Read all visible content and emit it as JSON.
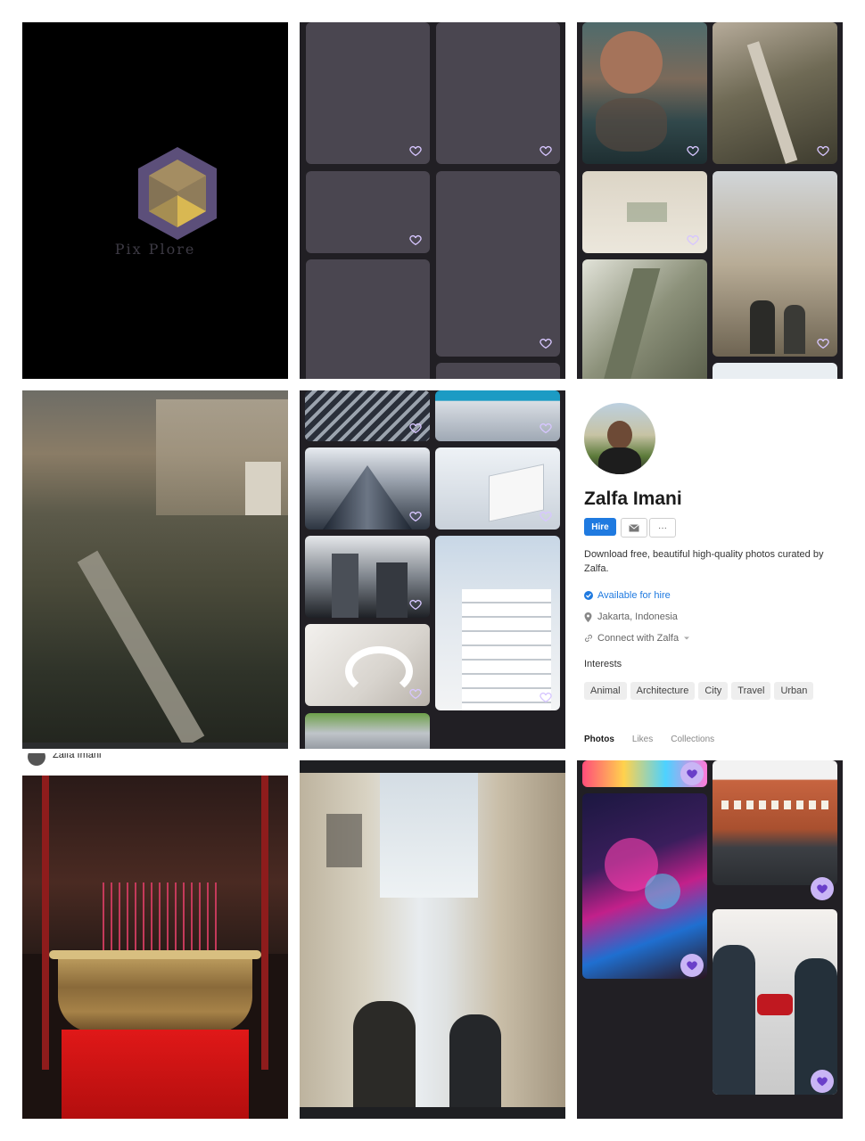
{
  "splash": {
    "brand_name": "Pix Plore"
  },
  "profile": {
    "name": "Zalfa Imani",
    "hire_label": "Hire",
    "more_label": "···",
    "bio": "Download free, beautiful high-quality photos curated by Zalfa.",
    "availability": "Available for hire",
    "location": "Jakarta, Indonesia",
    "connect_label": "Connect with Zalfa",
    "interests_heading": "Interests",
    "interests": [
      "Animal",
      "Architecture",
      "City",
      "Travel",
      "Urban"
    ],
    "tabs": [
      "Photos",
      "Likes",
      "Collections"
    ]
  },
  "photo_owner_caption": "Zalfa Imani",
  "colors": {
    "skeleton_bg": "#211f24",
    "skeleton_card": "#4a4650",
    "accent_blue": "#1f7ae0",
    "heart_purple": "#c9b5f5"
  }
}
